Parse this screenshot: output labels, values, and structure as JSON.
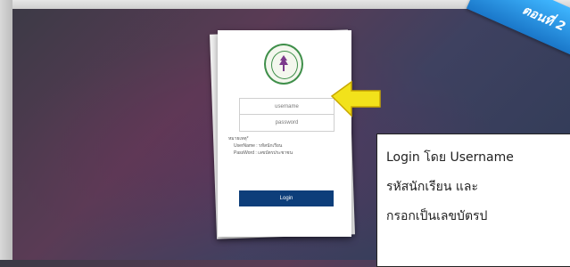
{
  "ribbon": {
    "text": "ตอนที่ 2"
  },
  "login_form": {
    "username_placeholder": "username",
    "password_placeholder": "password",
    "note_title": "หมายเหตุ*",
    "note_username": "UserName : รหัสนักเรียน",
    "note_password": "PassWord : เลขบัตรประชาชน",
    "login_label": "Login"
  },
  "callout": {
    "line1": "Login โดย Username",
    "line2": "รหัสนักเรียน และ",
    "line3": "กรอกเป็นเลขบัตรป"
  },
  "colors": {
    "accent": "#0d3e7a",
    "arrow": "#f2e21b",
    "ribbon": "#2a93e6"
  },
  "icons": {
    "seal": "school-seal-icon",
    "arrow": "pointer-arrow-icon"
  }
}
